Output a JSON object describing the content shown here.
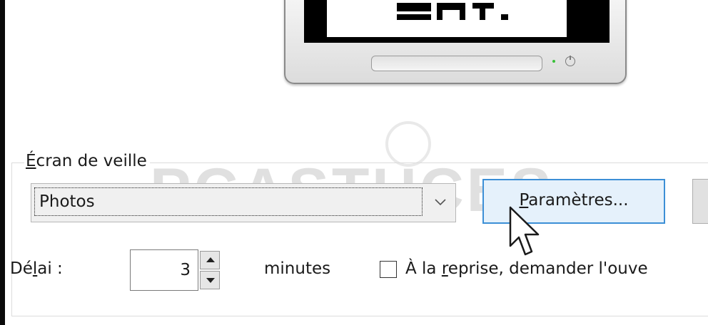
{
  "screensaver_group": {
    "legend_first": "É",
    "legend_rest": "cran de veille"
  },
  "screensaver_select": {
    "selected_value": "Photos"
  },
  "settings_button": {
    "label_first": "P",
    "label_rest": "aramètres..."
  },
  "delay": {
    "label_pre": "Dé",
    "label_accel": "l",
    "label_post": "ai :",
    "value": "3",
    "unit_label": "minutes"
  },
  "resume_checkbox": {
    "label_pre": "À la ",
    "label_accel": "r",
    "label_post": "eprise, demander l'ouve",
    "checked": false
  },
  "watermark": {
    "text": "PCASTUCES"
  },
  "icons": {
    "combo_arrow": "chevron-down-icon",
    "cursor": "mouse-pointer-icon",
    "spin_up": "triangle-up-icon",
    "spin_down": "triangle-down-icon"
  },
  "colors": {
    "button_focus_border": "#3c8fd6",
    "button_focus_bg": "#e5f1fb",
    "power_led": "#38c038"
  }
}
